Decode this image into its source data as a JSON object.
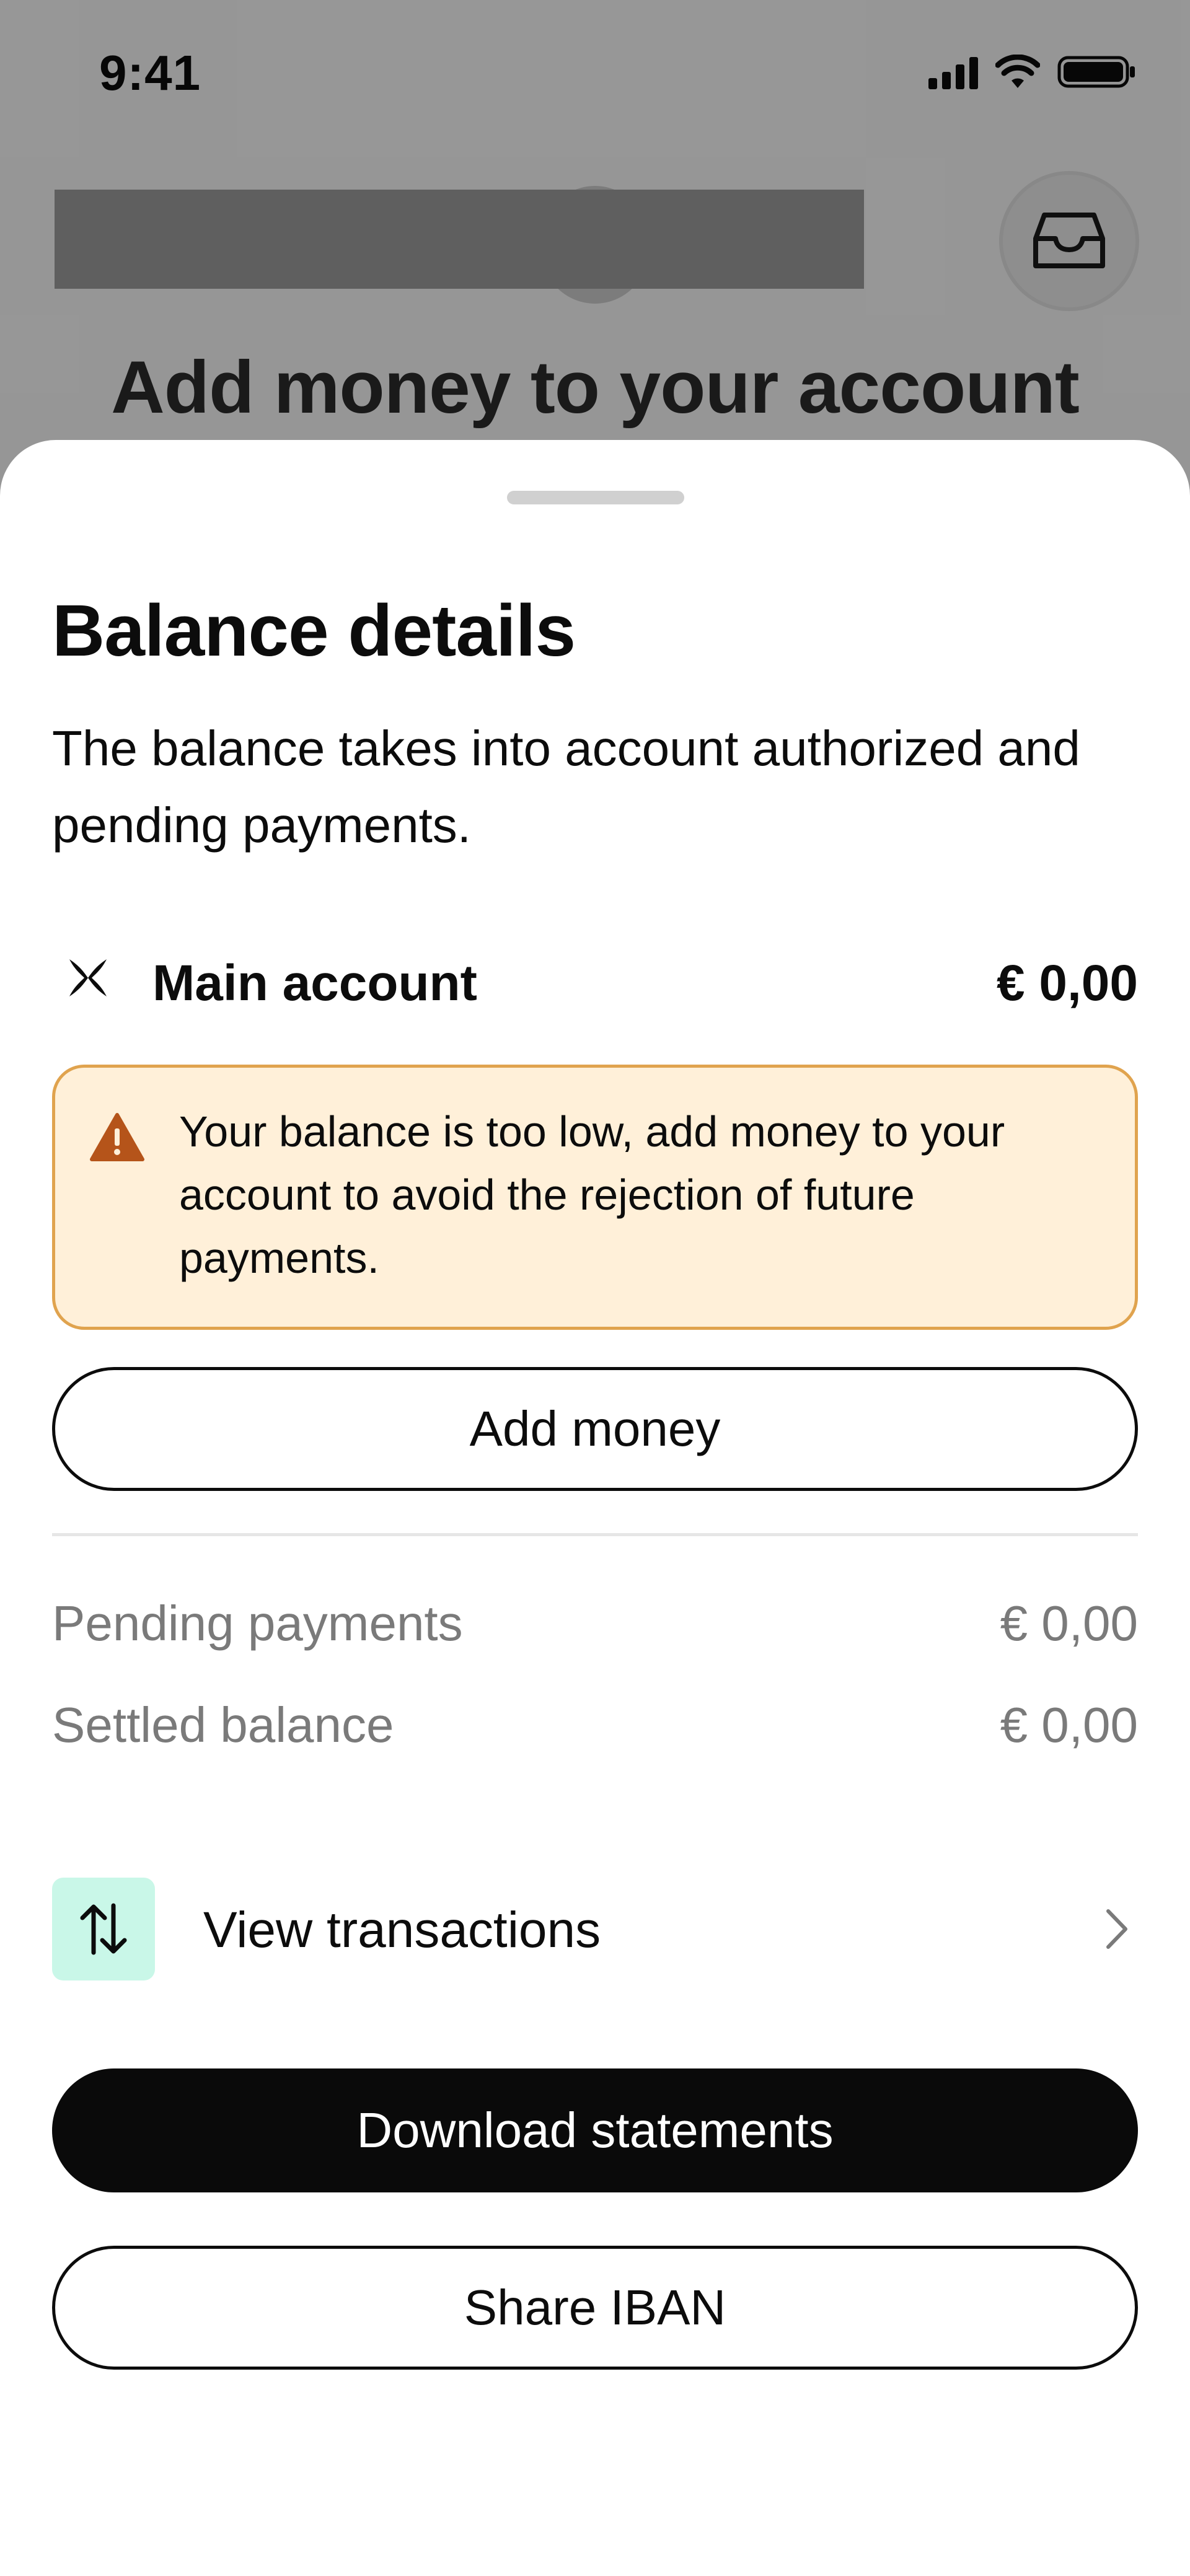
{
  "status_bar": {
    "time": "9:41",
    "icons": [
      "cellular-signal-icon",
      "wifi-icon",
      "battery-icon"
    ]
  },
  "background_screen": {
    "heading": "Add money to your account",
    "inbox_button_icon": "inbox-icon"
  },
  "sheet": {
    "title": "Balance details",
    "description": "The balance takes into account authorized and pending payments.",
    "account": {
      "icon": "account-logo-icon",
      "name": "Main account",
      "amount": "€ 0,00"
    },
    "warning": {
      "icon": "warning-triangle-icon",
      "text": "Your balance is too low, add money to your account to avoid the rejection of future payments."
    },
    "add_money_label": "Add money",
    "breakdown": [
      {
        "label": "Pending payments",
        "value": "€ 0,00"
      },
      {
        "label": "Settled balance",
        "value": "€ 0,00"
      }
    ],
    "view_transactions": {
      "icon": "transfer-arrows-icon",
      "label": "View transactions",
      "chevron": "chevron-right-icon"
    },
    "download_statements_label": "Download statements",
    "share_iban_label": "Share IBAN"
  },
  "colors": {
    "warning_bg": "#fff0d9",
    "warning_border": "#e0a34e",
    "warning_icon": "#b5541a",
    "transactions_icon_bg": "#c9f7e8",
    "primary_button": "#0a0a0a"
  }
}
